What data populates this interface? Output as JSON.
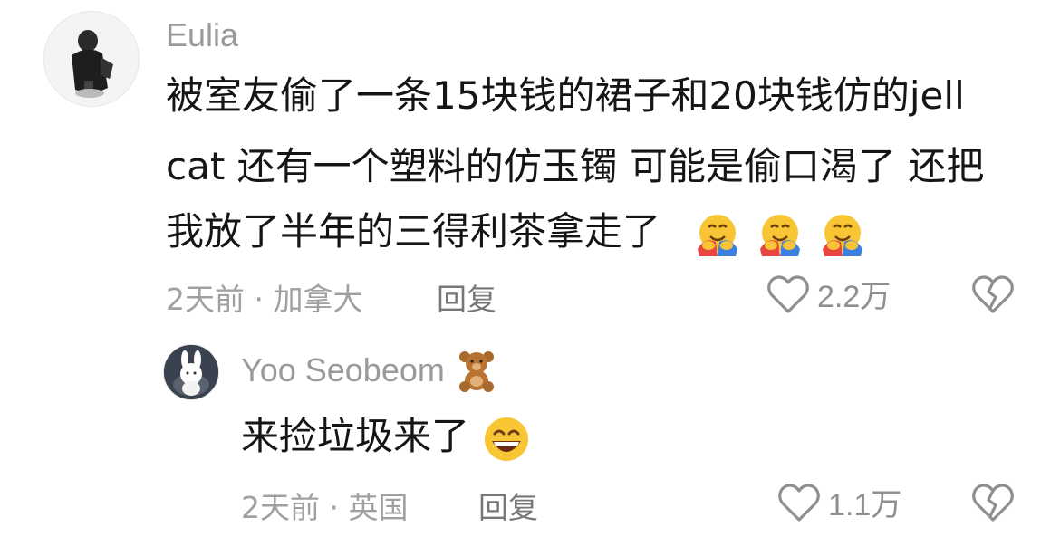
{
  "comments": [
    {
      "username": "Eulia",
      "avatar_icon": "user-avatar-photo",
      "text_lines": [
        "被室友偷了一条15块钱的裙子和20块钱仿的jell",
        "cat 还有一个塑料的仿玉镯 可能是偷口渴了 还把",
        "我放了半年的三得利茶拿走了"
      ],
      "trailing_emoji": [
        "hugging-face-emoji",
        "hugging-face-emoji",
        "hugging-face-emoji"
      ],
      "meta": "2天前 · 加拿大",
      "reply_label": "回复",
      "likes": "2.2万"
    },
    {
      "username": "Yoo Seobeom",
      "username_emoji": "teddy-bear-emoji",
      "avatar_icon": "bunny-avatar",
      "text_lines": [
        "来捡垃圾来了"
      ],
      "trailing_emoji": [
        "grinning-face-emoji"
      ],
      "meta": "2天前 · 英国",
      "reply_label": "回复",
      "likes": "1.1万"
    }
  ],
  "icons": {
    "like": "heart-outline-icon",
    "dislike": "broken-heart-icon"
  },
  "colors": {
    "username": "#9a9a9a",
    "text": "#151515",
    "meta": "#a0a0a0",
    "icon": "#8f8f8f"
  }
}
